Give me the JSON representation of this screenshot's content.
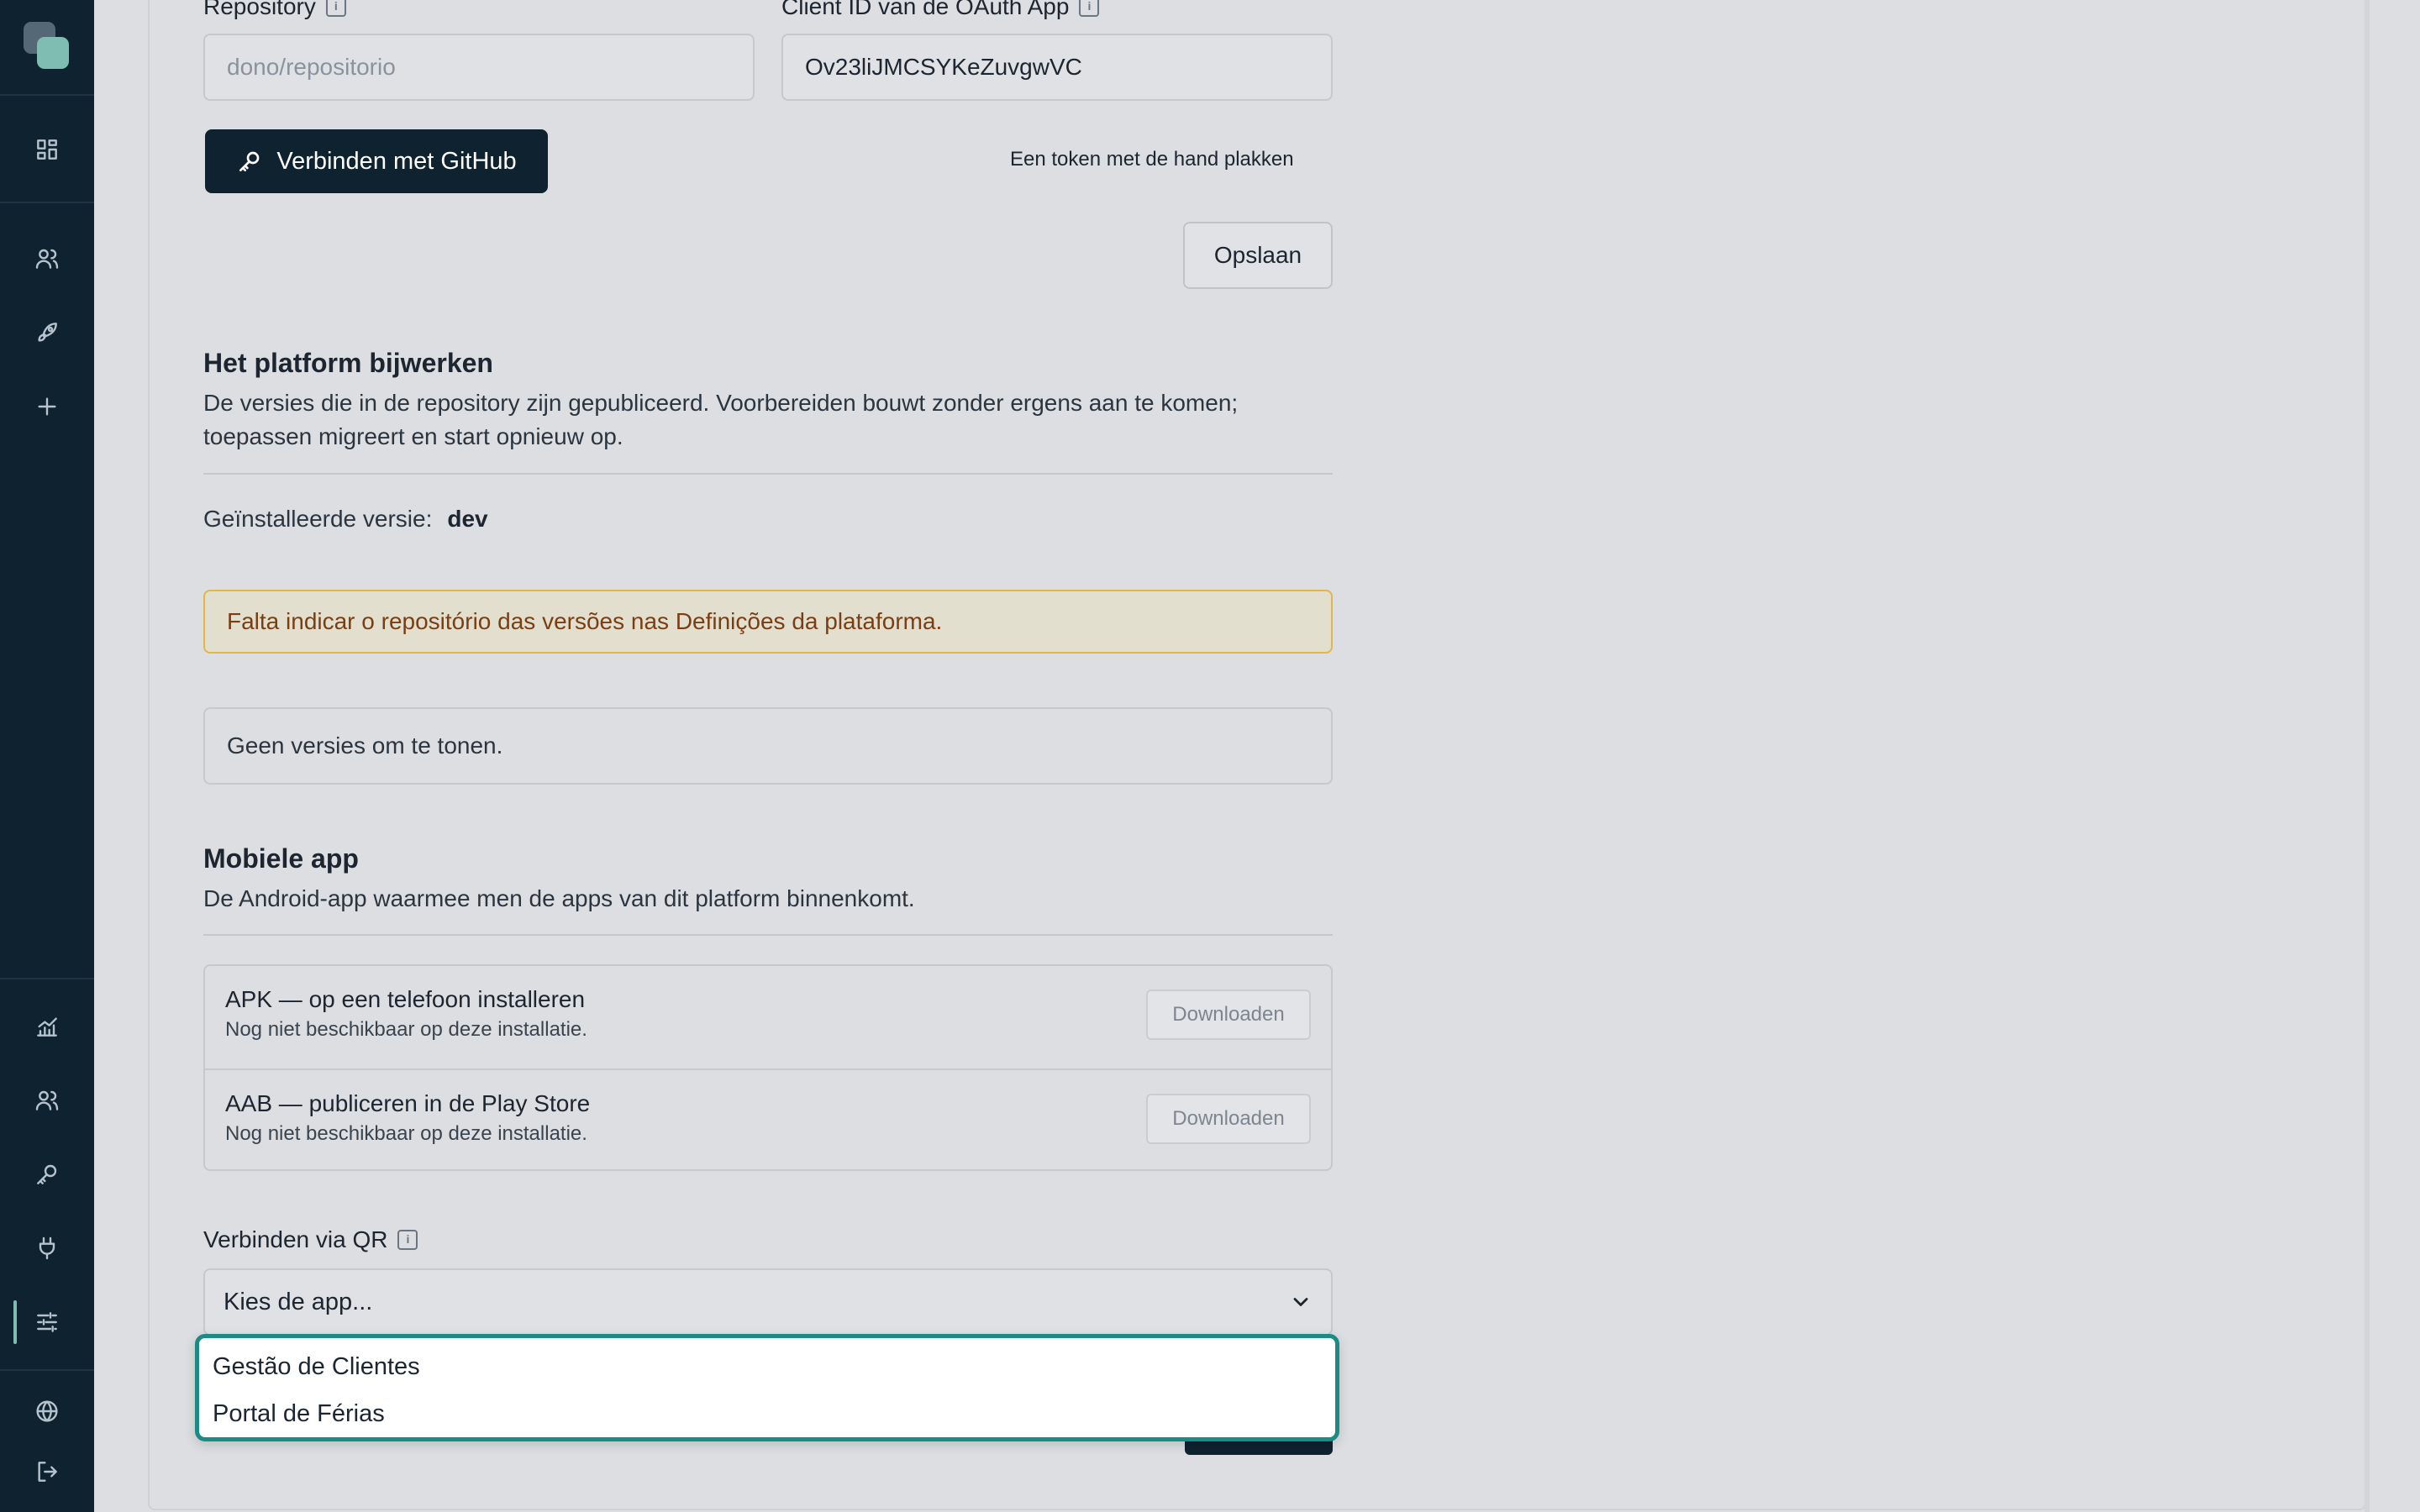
{
  "sidebar": {
    "top_items": [
      {
        "name": "dashboard-icon"
      },
      {
        "name": "users-icon"
      },
      {
        "name": "rocket-icon"
      },
      {
        "name": "plus-icon"
      }
    ],
    "bottom_items": [
      {
        "name": "chart-icon"
      },
      {
        "name": "team-icon"
      },
      {
        "name": "key-icon"
      },
      {
        "name": "plug-icon"
      },
      {
        "name": "settings-sliders-icon",
        "active": true
      },
      {
        "name": "globe-icon"
      },
      {
        "name": "logout-icon"
      }
    ]
  },
  "github": {
    "repository_label": "Repository",
    "repository_placeholder": "dono/repositorio",
    "client_id_label": "Client ID van de OAuth App",
    "client_id_value": "Ov23liJMCSYKeZuvgwVC",
    "connect_label": "Verbinden met GitHub",
    "paste_token_label": "Een token met de hand plakken",
    "save_label": "Opslaan"
  },
  "update": {
    "title": "Het platform bijwerken",
    "description_line1": "De versies die in de repository zijn gepubliceerd. Voorbereiden bouwt zonder ergens aan te komen;",
    "description_line2": "toepassen migreert en start opnieuw op.",
    "installed_label": "Geïnstalleerde versie:",
    "installed_value": "dev",
    "warning": "Falta indicar o repositório das versões nas Definições da plataforma.",
    "empty": "Geen versies om te tonen."
  },
  "mobile": {
    "title": "Mobiele app",
    "description": "De Android-app waarmee men de apps van dit platform binnenkomt.",
    "builds": [
      {
        "name": "APK — op een telefoon installeren",
        "status": "Nog niet beschikbaar op deze installatie.",
        "button": "Downloaden"
      },
      {
        "name": "AAB — publiceren in de Play Store",
        "status": "Nog niet beschikbaar op deze installatie.",
        "button": "Downloaden"
      }
    ],
    "qr_label": "Verbinden via QR",
    "select_placeholder": "Kies de app...",
    "options": [
      "Gestão de Clientes",
      "Portal de Férias"
    ]
  },
  "colors": {
    "sidebar": "#0f2230",
    "accent": "#7fbcb2",
    "focus": "#1a8c84",
    "warning_border": "#e0b84a",
    "warning_text": "#7a3e12"
  }
}
